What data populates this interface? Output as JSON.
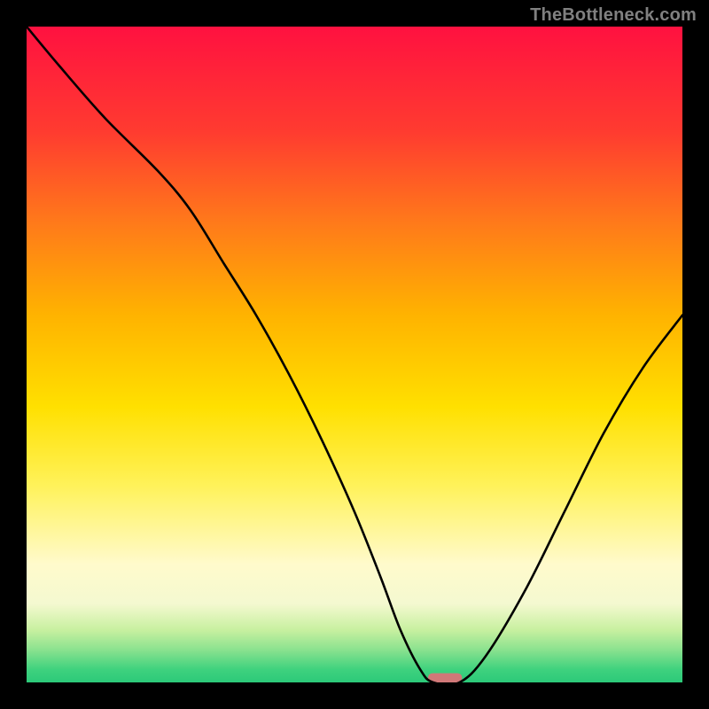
{
  "watermark": "TheBottleneck.com",
  "chart_data": {
    "type": "line",
    "title": "",
    "xlabel": "",
    "ylabel": "",
    "xlim": [
      0,
      100
    ],
    "ylim": [
      0,
      100
    ],
    "grid": false,
    "legend": false,
    "background": {
      "bands": [
        {
          "y": 100,
          "color": "#ff1140"
        },
        {
          "y": 84,
          "color": "#ff3b30"
        },
        {
          "y": 70,
          "color": "#ff7a1a"
        },
        {
          "y": 56,
          "color": "#ffb300"
        },
        {
          "y": 42,
          "color": "#ffe000"
        },
        {
          "y": 30,
          "color": "#fff25a"
        },
        {
          "y": 18,
          "color": "#fffacc"
        },
        {
          "y": 12,
          "color": "#f4f9d0"
        },
        {
          "y": 8,
          "color": "#c8f0a0"
        },
        {
          "y": 5,
          "color": "#8be28f"
        },
        {
          "y": 2,
          "color": "#3fd27e"
        },
        {
          "y": 0,
          "color": "#2cc979"
        }
      ]
    },
    "series": [
      {
        "name": "bottleneck-curve",
        "x": [
          0,
          5,
          12,
          20,
          25,
          30,
          35,
          40,
          45,
          50,
          54,
          57,
          60,
          62,
          66,
          70,
          76,
          82,
          88,
          94,
          100
        ],
        "y": [
          100,
          94,
          86,
          78,
          72,
          64,
          56,
          47,
          37,
          26,
          16,
          8,
          2,
          0,
          0,
          4,
          14,
          26,
          38,
          48,
          56
        ]
      }
    ],
    "marker": {
      "name": "optimal-range",
      "x_center": 63.8,
      "y_center": 0.7,
      "width": 5.2,
      "height": 1.4,
      "color": "#d07878"
    }
  }
}
